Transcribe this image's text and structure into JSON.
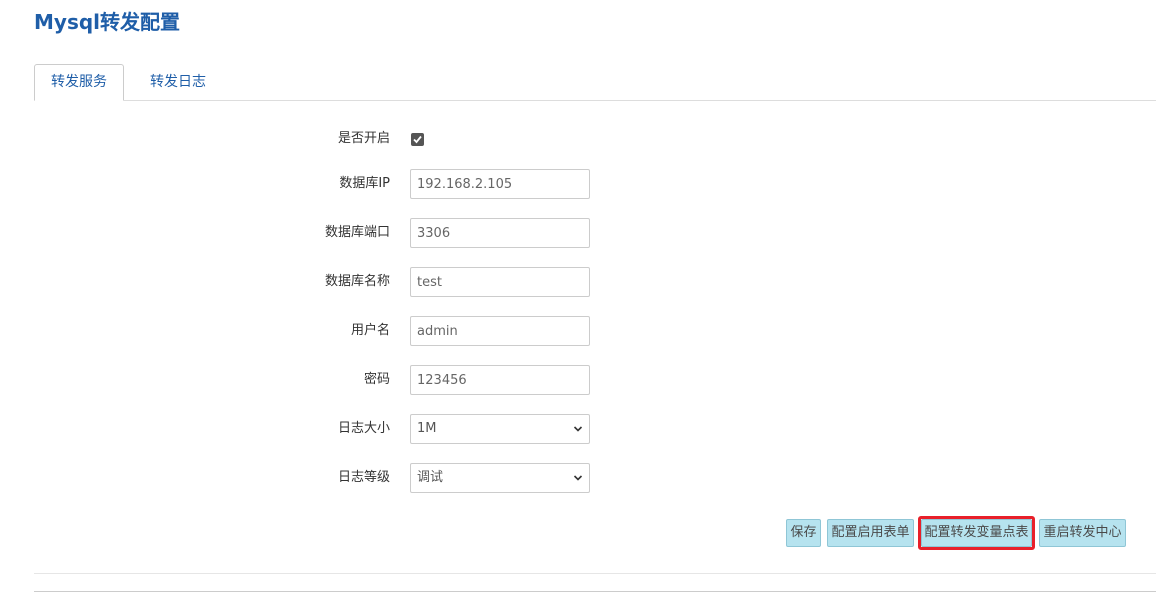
{
  "page": {
    "title": "Mysql转发配置"
  },
  "tabs": [
    {
      "label": "转发服务",
      "active": true
    },
    {
      "label": "转发日志",
      "active": false
    }
  ],
  "form": {
    "enabled": {
      "label": "是否开启",
      "checked": true
    },
    "db_ip": {
      "label": "数据库IP",
      "value": "192.168.2.105"
    },
    "db_port": {
      "label": "数据库端口",
      "value": "3306"
    },
    "db_name": {
      "label": "数据库名称",
      "value": "test"
    },
    "username": {
      "label": "用户名",
      "value": "admin"
    },
    "password": {
      "label": "密码",
      "value": "123456"
    },
    "log_size": {
      "label": "日志大小",
      "selected": "1M"
    },
    "log_level": {
      "label": "日志等级",
      "selected": "调试"
    }
  },
  "buttons": {
    "save": "保存",
    "config_enable_table": "配置启用表单",
    "config_variable_table": "配置转发变量点表",
    "restart_center": "重启转发中心"
  },
  "colors": {
    "title": "#1f5ea8",
    "button_bg": "#b6e3ef",
    "highlight": "#e8202a"
  }
}
